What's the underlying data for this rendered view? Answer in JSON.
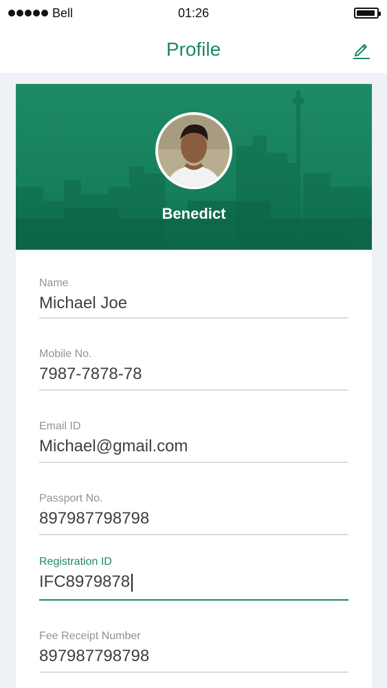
{
  "status_bar": {
    "carrier": "Bell",
    "time": "01:26"
  },
  "nav": {
    "title": "Profile",
    "edit_icon": "pencil-edit-icon"
  },
  "profile": {
    "display_name": "Benedict",
    "avatar_icon": "avatar-photo"
  },
  "fields": [
    {
      "label": "Name",
      "value": "Michael Joe"
    },
    {
      "label": "Mobile No.",
      "value": "7987-7878-78"
    },
    {
      "label": "Email ID",
      "value": "Michael@gmail.com"
    },
    {
      "label": "Passport No.",
      "value": "897987798798"
    },
    {
      "label": "Registration ID",
      "value": "IFC8979878",
      "active": true
    },
    {
      "label": "Fee Receipt Number",
      "value": "897987798798"
    }
  ],
  "colors": {
    "accent": "#1c8a63",
    "banner": "#1a8461",
    "background": "#eef1f5"
  }
}
